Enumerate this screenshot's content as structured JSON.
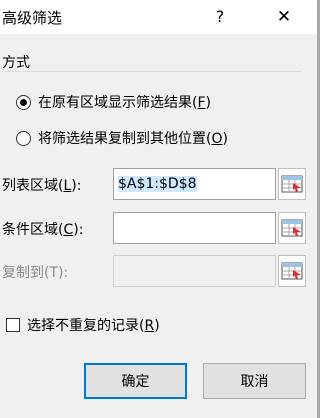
{
  "window": {
    "title": "高级筛选",
    "help_label": "?",
    "close_label": "✕"
  },
  "method": {
    "title": "方式",
    "options": [
      {
        "label": "在原有区域显示筛选结果(",
        "key": "F",
        "suffix": ")",
        "checked": true
      },
      {
        "label": "将筛选结果复制到其他位置(",
        "key": "O",
        "suffix": ")",
        "checked": false
      }
    ]
  },
  "fields": {
    "list_range": {
      "label": "列表区域(",
      "key": "L",
      "suffix": "):",
      "value": "$A$1:$D$8"
    },
    "criteria_range": {
      "label": "条件区域(",
      "key": "C",
      "suffix": "):",
      "value": ""
    },
    "copy_to": {
      "label": "复制到(T):",
      "value": ""
    }
  },
  "unique_records": {
    "label": "选择不重复的记录(",
    "key": "R",
    "suffix": ")",
    "checked": false
  },
  "buttons": {
    "ok": "确定",
    "cancel": "取消"
  },
  "colors": {
    "accent": "#0078d7",
    "selection": "#cde8ff"
  },
  "icons": {
    "range_ref": "range-selector-icon"
  }
}
